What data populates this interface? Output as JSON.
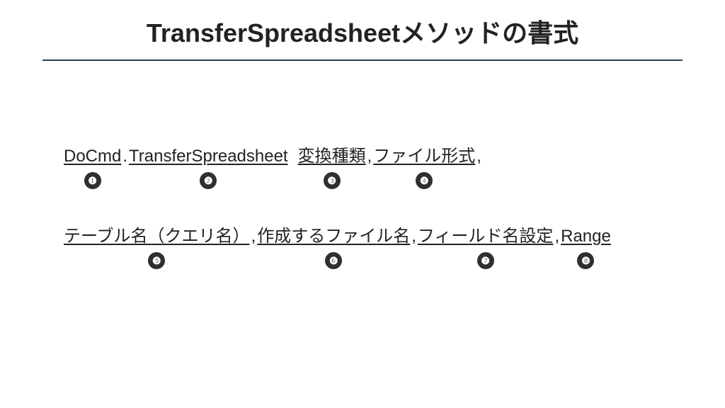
{
  "title": "TransferSpreadsheetメソッドの書式",
  "line1": {
    "t1": "DoCmd",
    "dot": ".",
    "t2": "TransferSpreadsheet",
    "t3": "変換種類",
    "c1": ",",
    "t4": "ファイル形式",
    "c2": ","
  },
  "line2": {
    "t5": "テーブル名（クエリ名）",
    "c3": ",",
    "t6": "作成するファイル名",
    "c4": ",",
    "t7": "フィールド名設定",
    "c5": ",",
    "t8": "Range"
  },
  "badges": {
    "b1": "❶",
    "b2": "❷",
    "b3": "❸",
    "b4": "❹",
    "b5": "❺",
    "b6": "❻",
    "b7": "❼",
    "b8": "❽"
  }
}
